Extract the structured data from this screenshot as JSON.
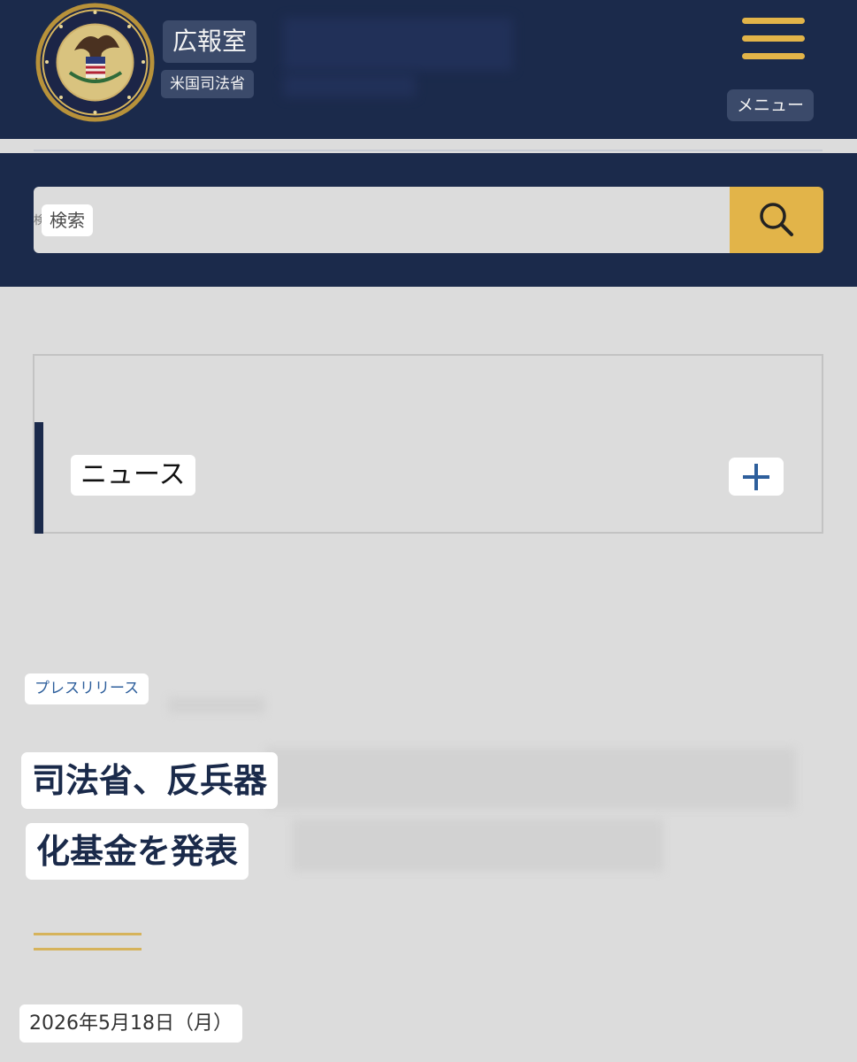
{
  "header": {
    "office_title": "広報室",
    "department": "米国司法省",
    "menu_label": "メニュー",
    "seal_icon": "doj-seal-icon",
    "colors": {
      "navy": "#1b2a4b",
      "gold": "#e2b449"
    }
  },
  "search": {
    "placeholder": "検索",
    "button_icon": "search-icon"
  },
  "news_section": {
    "label": "ニュース",
    "expand_icon": "plus-icon"
  },
  "article": {
    "category": "プレスリリース",
    "headline_lines": [
      "司法省、反兵器",
      "化基金を発表"
    ],
    "date": "2026年5月18日（月）"
  }
}
